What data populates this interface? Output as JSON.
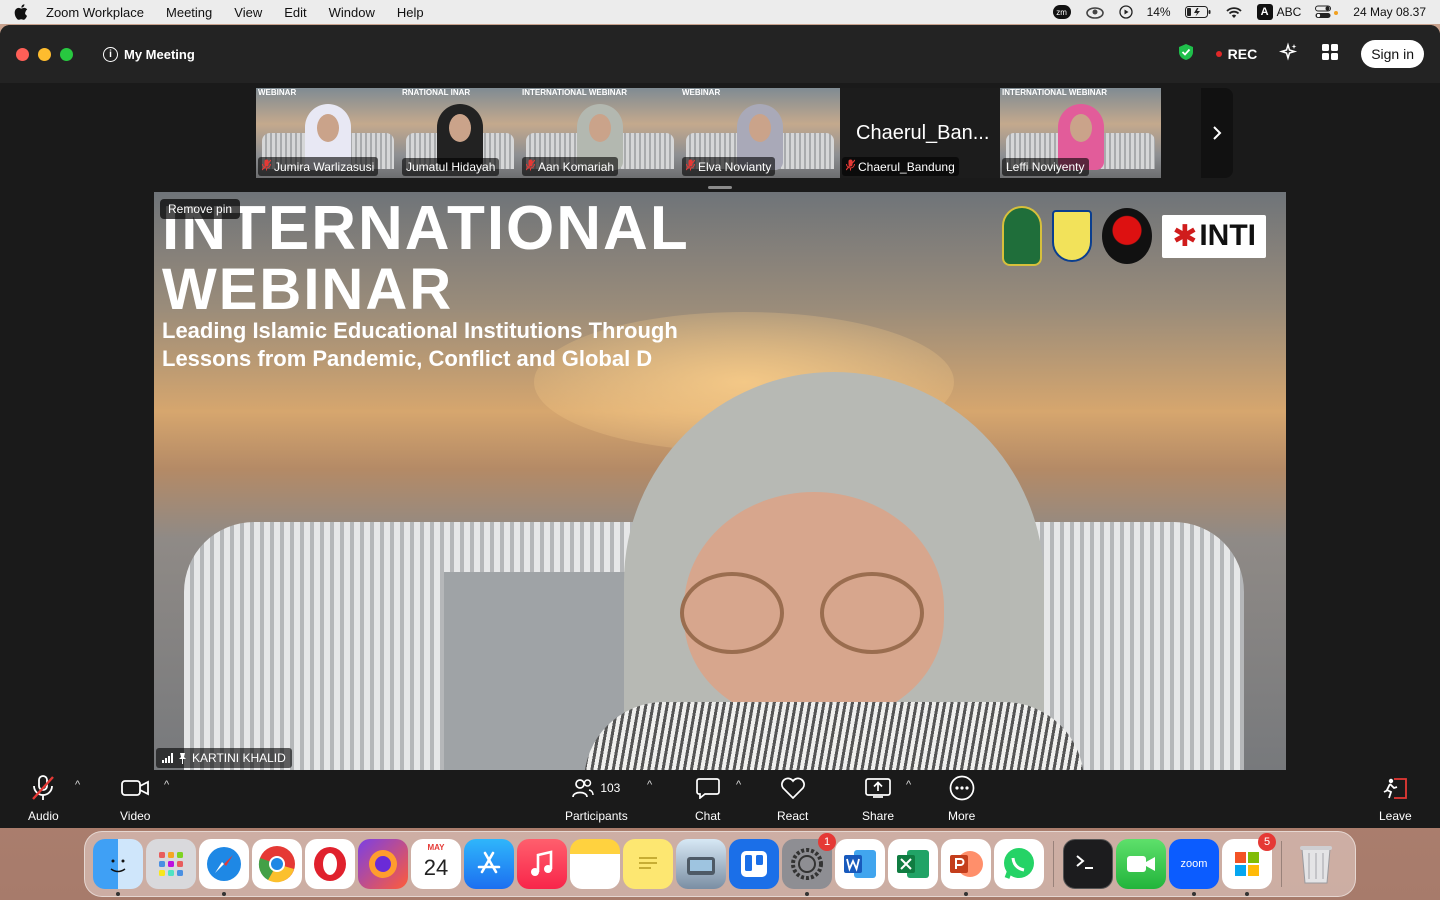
{
  "menubar": {
    "app": "Zoom Workplace",
    "menus": [
      "Meeting",
      "View",
      "Edit",
      "Window",
      "Help"
    ],
    "battery": "14%",
    "input_source": "ABC",
    "input_letter": "A",
    "zm_label": "zm",
    "clock": "24 May  08.37"
  },
  "window": {
    "title": "My Meeting",
    "rec_label": "REC",
    "sign_in": "Sign in"
  },
  "thumbnails": [
    {
      "name": "Jumira Warlizasusi",
      "header": "WEBINAR",
      "muted": true,
      "hijab": "#e8e8f4"
    },
    {
      "name": "Jumatul Hidayah",
      "header": "RNATIONAL INAR",
      "muted": false,
      "hijab": "#222222"
    },
    {
      "name": "Aan Komariah",
      "header": "INTERNATIONAL WEBINAR",
      "muted": true,
      "hijab": "#b3b8b0"
    },
    {
      "name": "Elva Novianty",
      "header": "WEBINAR",
      "muted": true,
      "hijab": "#a9a9b8"
    },
    {
      "name": "Chaerul_Bandung",
      "big_label": "Chaerul_Ban...",
      "muted": true,
      "video_off": true
    },
    {
      "name": "Leffi Noviyenty",
      "header": "INTERNATIONAL WEBINAR",
      "muted": false,
      "hijab": "#e25c9a"
    }
  ],
  "main_video": {
    "remove_pin": "Remove pin",
    "title_line1": "INTERNATIONAL",
    "title_line2": "WEBINAR",
    "subtitle_line1": "Leading Islamic Educational Institutions Through",
    "subtitle_line2": "Lessons from Pandemic, Conflict and Global D",
    "logo_text": "INTI",
    "speaker_name": "KARTINI KHALID"
  },
  "toolbar": {
    "audio": "Audio",
    "video": "Video",
    "participants": "Participants",
    "participants_count": "103",
    "chat": "Chat",
    "react": "React",
    "share": "Share",
    "more": "More",
    "leave": "Leave"
  },
  "dock": {
    "calendar_month": "MAY",
    "calendar_day": "24",
    "settings_badge": "1",
    "windows_badge": "5",
    "zoom_label": "zoom"
  }
}
